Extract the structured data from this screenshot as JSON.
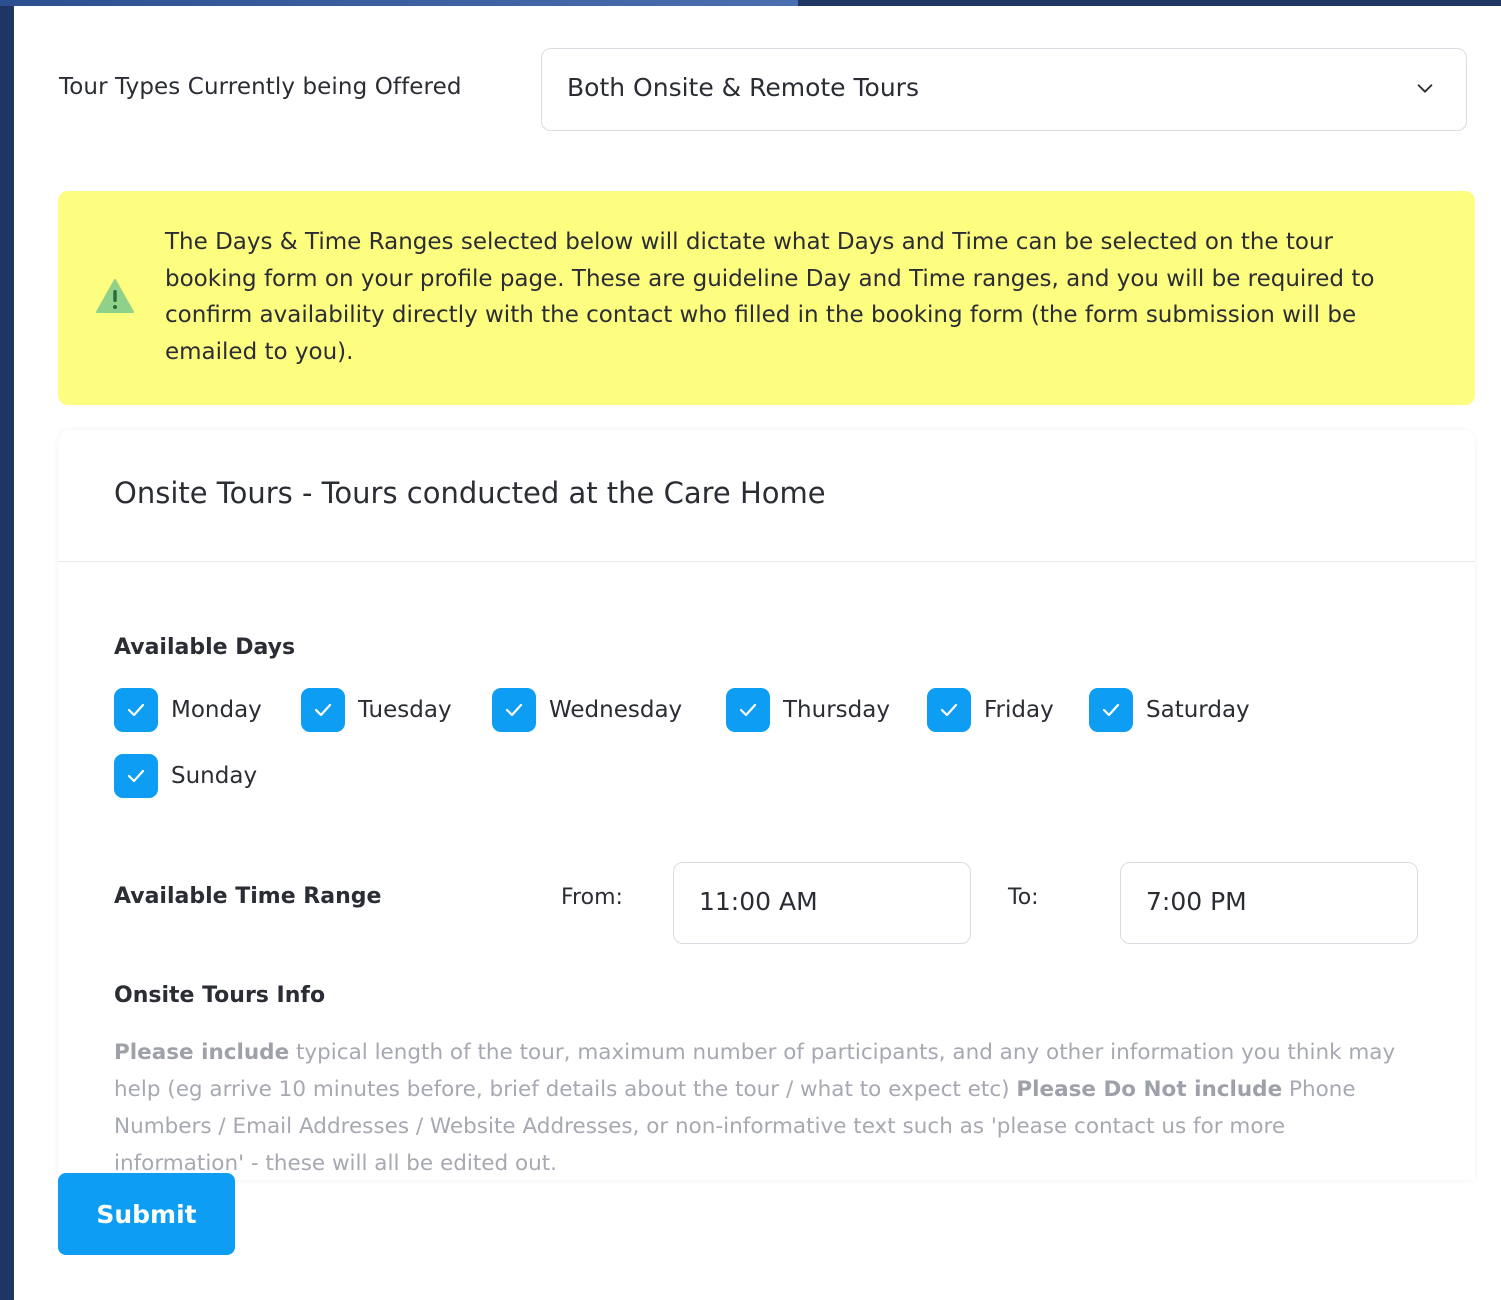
{
  "tour_type": {
    "label": "Tour Types Currently being Offered",
    "selected": "Both Onsite & Remote Tours"
  },
  "alert": {
    "icon": "warning-icon",
    "text": "The Days & Time Ranges selected below will dictate what Days and Time can be selected on the tour booking form on your profile page. These are guideline Day and Time ranges, and you will be required to confirm availability directly with the contact who filled in the booking form (the form submission will be emailed to you)."
  },
  "onsite": {
    "title": "Onsite Tours - Tours conducted at the Care Home",
    "days_label": "Available Days",
    "days": [
      {
        "label": "Monday",
        "checked": true
      },
      {
        "label": "Tuesday",
        "checked": true
      },
      {
        "label": "Wednesday",
        "checked": true
      },
      {
        "label": "Thursday",
        "checked": true
      },
      {
        "label": "Friday",
        "checked": true
      },
      {
        "label": "Saturday",
        "checked": true
      },
      {
        "label": "Sunday",
        "checked": true
      }
    ],
    "time_label": "Available Time Range",
    "from_label": "From:",
    "from_value": "11:00 AM",
    "to_label": "To:",
    "to_value": "7:00 PM",
    "info_label": "Onsite Tours Info",
    "info_help": {
      "bold1": "Please include",
      "text1": " typical length of the tour, maximum number of participants, and any other information you think may help (eg arrive 10 minutes before, brief details about the tour / what to expect etc) ",
      "bold2": "Please Do Not include",
      "text2": " Phone Numbers / Email Addresses / Website Addresses, or non-informative text such as 'please contact us for more information' - these will all be edited out."
    }
  },
  "submit_label": "Submit",
  "colors": {
    "accent": "#0d9df2",
    "alert_bg": "#fdfd7f",
    "background": "#1f3563"
  }
}
